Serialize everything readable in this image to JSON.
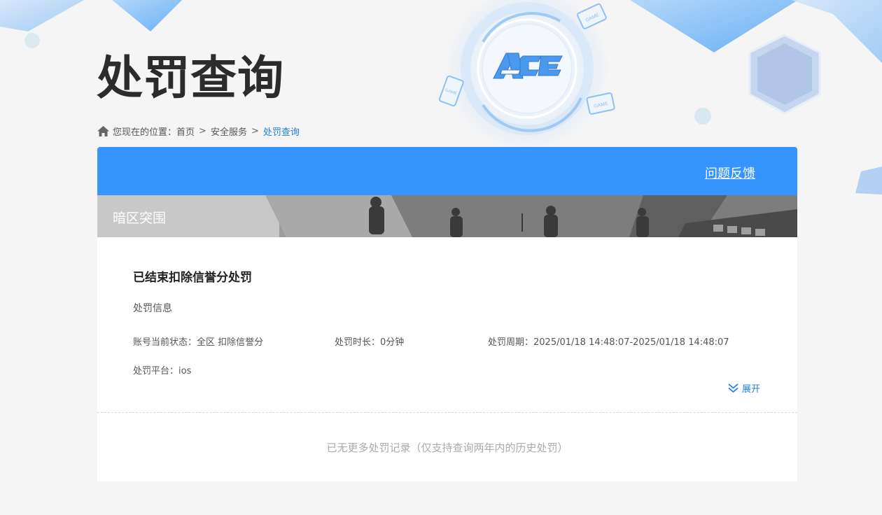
{
  "page": {
    "title": "处罚查询"
  },
  "breadcrumb": {
    "prefix": "您现在的位置：",
    "items": [
      "首页",
      "安全服务",
      "处罚查询"
    ],
    "separator": ">"
  },
  "header": {
    "feedback_label": "问题反馈",
    "accent_color": "#3694fe"
  },
  "game": {
    "name": "暗区突围"
  },
  "record": {
    "title": "已结束扣除信誉分处罚",
    "section_label": "处罚信息",
    "status": "账号当前状态：全区 扣除信誉分",
    "duration": "处罚时长：0分钟",
    "period": "处罚周期：2025/01/18 14:48:07-2025/01/18 14:48:07",
    "platform": "处罚平台：ios",
    "expand_label": "展开"
  },
  "footer": {
    "note": "已无更多处罚记录（仅支持查询两年内的历史处罚）"
  },
  "icons": [
    "home-icon",
    "ace-logo",
    "double-chevron-down-icon"
  ]
}
